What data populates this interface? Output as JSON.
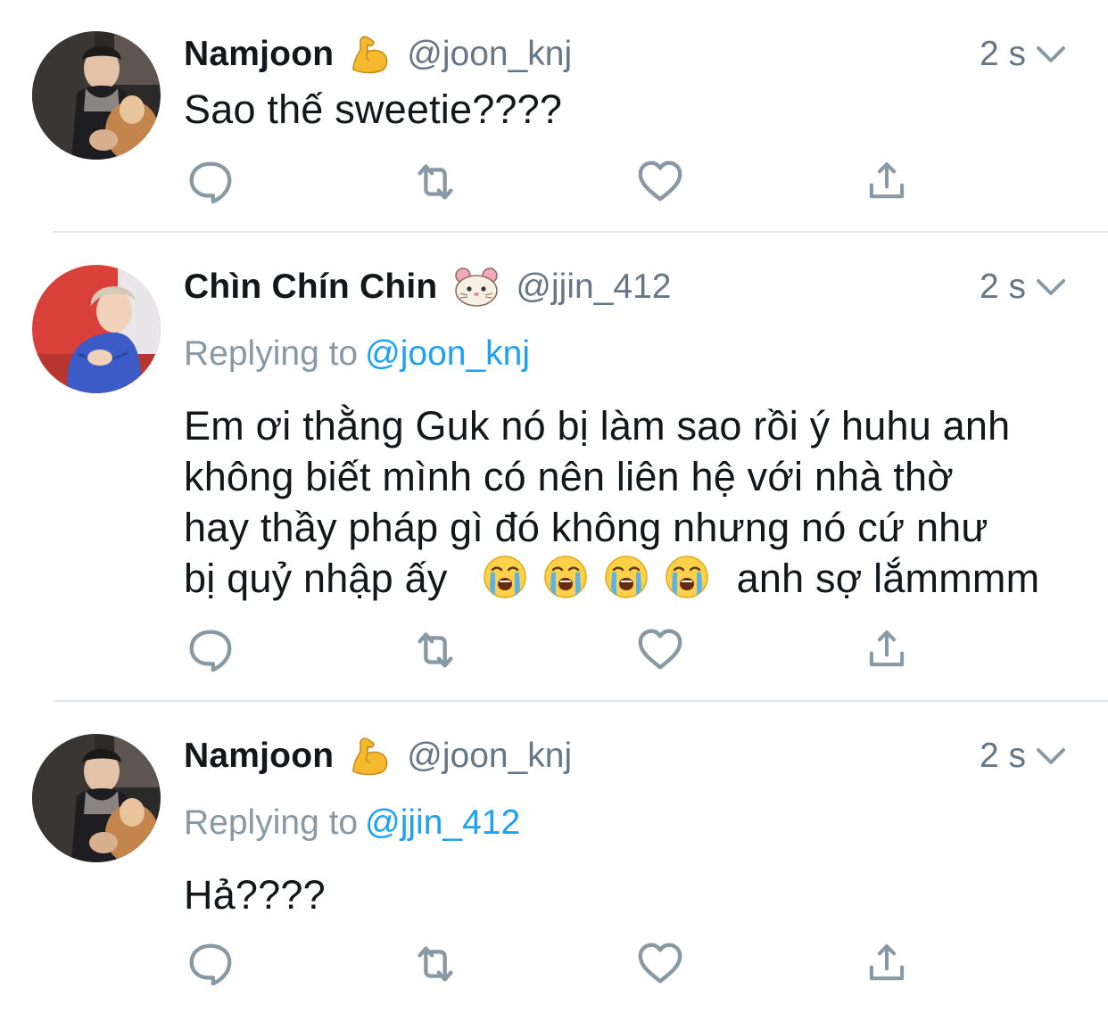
{
  "tweets": [
    {
      "name": "Namjoon",
      "badge_emoji": "flexed-biceps",
      "handle": "@joon_knj",
      "time": "2 s",
      "replying_label": "",
      "replying_to": "",
      "text_lines": [
        "Sao thế sweetie????"
      ],
      "avatar": "namjoon-avatar"
    },
    {
      "name": "Chìn Chín Chin",
      "badge_emoji": "hamster-face",
      "handle": "@jjin_412",
      "time": "2 s",
      "replying_label": "Replying to",
      "replying_to": "@joon_knj",
      "text_lines": [
        "Em ơi thằng Guk nó bị làm sao rồi ý huhu anh",
        "không biết mình có nên liên hệ với nhà thờ",
        "hay thầy pháp gì đó không nhưng nó cứ như",
        "bị quỷ nhập ấy",
        "anh sợ lắmmmm"
      ],
      "inline_emojis": [
        "loudly-crying-face",
        "loudly-crying-face",
        "loudly-crying-face",
        "loudly-crying-face"
      ],
      "avatar": "jin-avatar"
    },
    {
      "name": "Namjoon",
      "badge_emoji": "flexed-biceps",
      "handle": "@joon_knj",
      "time": "2 s",
      "replying_label": "Replying to",
      "replying_to": "@jjin_412",
      "text_lines": [
        "Hả????"
      ],
      "avatar": "namjoon-avatar"
    }
  ],
  "actions": [
    "reply-icon",
    "retweet-icon",
    "like-icon",
    "share-icon"
  ],
  "colors": {
    "text": "#14171a",
    "secondary": "#657786",
    "replying": "#8899a6",
    "link": "#1da1f2",
    "icon": "#8899a6",
    "divider": "#e1e8ed"
  }
}
